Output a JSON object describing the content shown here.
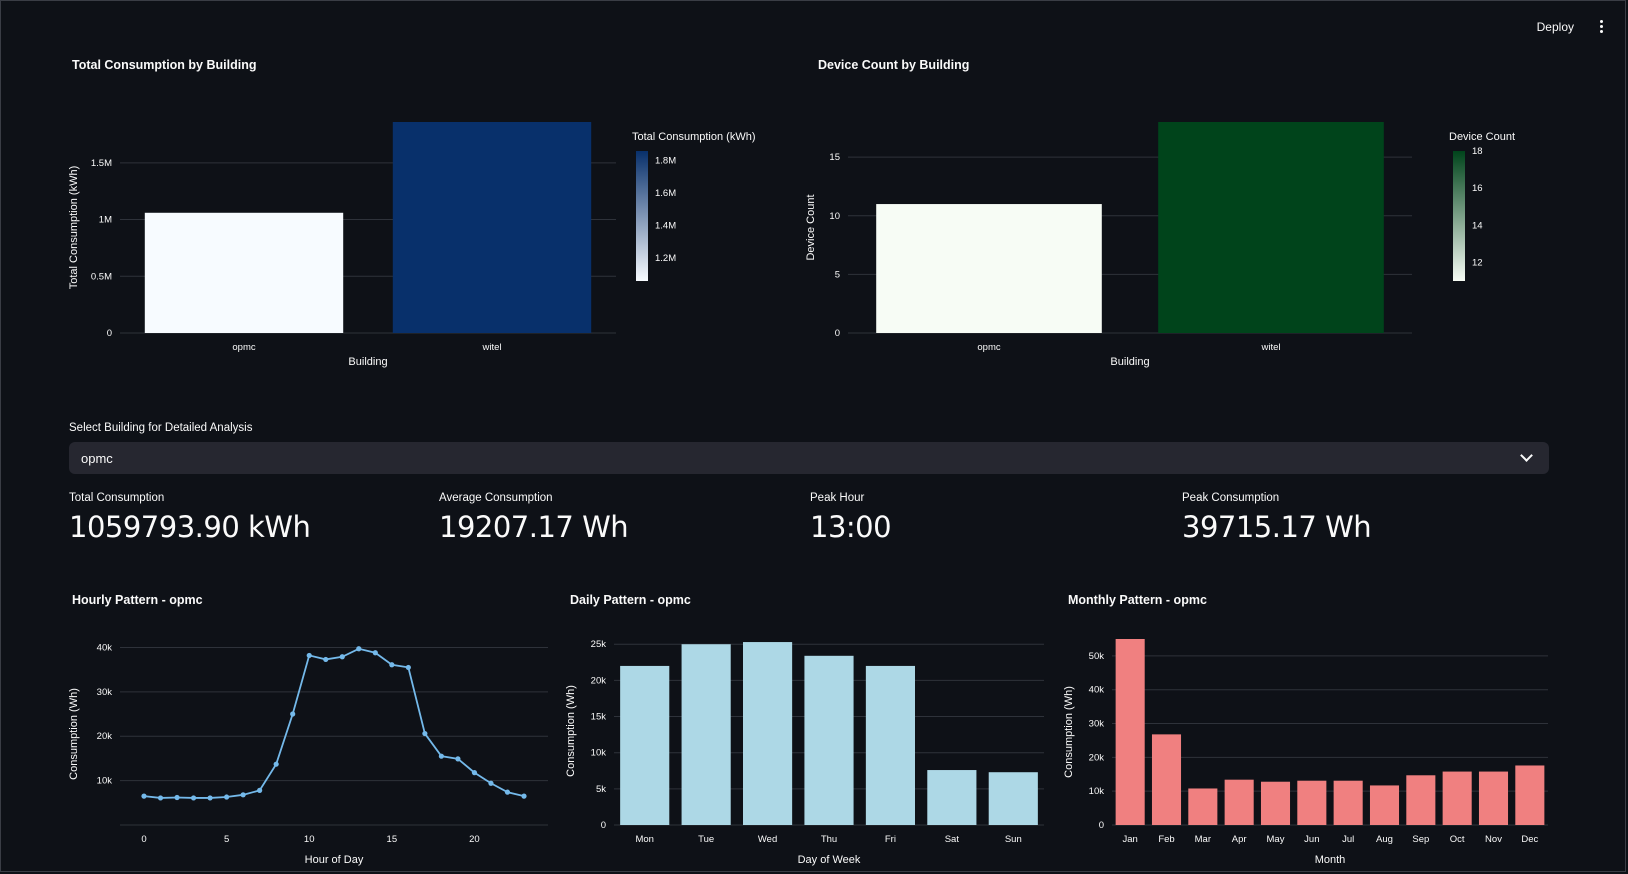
{
  "header": {
    "deploy_label": "Deploy",
    "menu_icon": "kebab-menu-icon"
  },
  "consumption_chart": {
    "title": "Total Consumption by Building",
    "xlabel": "Building",
    "ylabel": "Total Consumption (kWh)",
    "colorbar_title": "Total Consumption (kWh)",
    "colorbar_ticks": [
      "1.8M",
      "1.6M",
      "1.4M",
      "1.2M"
    ]
  },
  "device_chart": {
    "title": "Device Count by Building",
    "xlabel": "Building",
    "ylabel": "Device Count",
    "colorbar_title": "Device Count",
    "colorbar_ticks": [
      "18",
      "16",
      "14",
      "12"
    ]
  },
  "selector": {
    "label": "Select Building for Detailed Analysis",
    "value": "opmc",
    "chevron_icon": "chevron-down-icon"
  },
  "metrics": [
    {
      "label": "Total Consumption",
      "value": "1059793.90 kWh"
    },
    {
      "label": "Average Consumption",
      "value": "19207.17 Wh"
    },
    {
      "label": "Peak Hour",
      "value": "13:00"
    },
    {
      "label": "Peak Consumption",
      "value": "39715.17 Wh"
    }
  ],
  "chart_data": [
    {
      "type": "bar",
      "title": "Total Consumption by Building",
      "xlabel": "Building",
      "ylabel": "Total Consumption (kWh)",
      "categories": [
        "opmc",
        "witel"
      ],
      "values": [
        1059793.9,
        1860000
      ],
      "ylim": [
        0,
        1860000
      ],
      "yticks": [
        0,
        500000,
        1000000,
        1500000
      ],
      "ytick_labels": [
        "0",
        "0.5M",
        "1M",
        "1.5M"
      ],
      "colorscale": "Blues",
      "colors": [
        "#f7fbff",
        "#08306b"
      ],
      "legend": "colorbar-right"
    },
    {
      "type": "bar",
      "title": "Device Count by Building",
      "xlabel": "Building",
      "ylabel": "Device Count",
      "categories": [
        "opmc",
        "witel"
      ],
      "values": [
        11,
        18
      ],
      "ylim": [
        0,
        18
      ],
      "yticks": [
        0,
        5,
        10,
        15
      ],
      "ytick_labels": [
        "0",
        "5",
        "10",
        "15"
      ],
      "colorscale": "Greens",
      "colors": [
        "#f7fcf5",
        "#00441b"
      ],
      "legend": "colorbar-right"
    },
    {
      "type": "line",
      "title": "Hourly Pattern - opmc",
      "xlabel": "Hour of Day",
      "ylabel": "Consumption (Wh)",
      "x": [
        0,
        1,
        2,
        3,
        4,
        5,
        6,
        7,
        8,
        9,
        10,
        11,
        12,
        13,
        14,
        15,
        16,
        17,
        18,
        19,
        20,
        21,
        22,
        23
      ],
      "y": [
        6500,
        6100,
        6200,
        6100,
        6100,
        6300,
        6800,
        7800,
        13700,
        25000,
        38200,
        37300,
        37900,
        39700,
        38800,
        36100,
        35500,
        20600,
        15500,
        14900,
        11800,
        9400,
        7400,
        6500
      ],
      "ylim": [
        0,
        41000
      ],
      "yticks": [
        10000,
        20000,
        30000,
        40000
      ],
      "ytick_labels": [
        "10k",
        "20k",
        "30k",
        "40k"
      ],
      "xticks": [
        0,
        5,
        10,
        15,
        20
      ],
      "xtick_labels": [
        "0",
        "5",
        "10",
        "15",
        "20"
      ],
      "color": "#74b9ea"
    },
    {
      "type": "bar",
      "title": "Daily Pattern - opmc",
      "xlabel": "Day of Week",
      "ylabel": "Consumption (Wh)",
      "categories": [
        "Mon",
        "Tue",
        "Wed",
        "Thu",
        "Fri",
        "Sat",
        "Sun"
      ],
      "values": [
        22000,
        25000,
        25300,
        23400,
        22000,
        7600,
        7300
      ],
      "ylim": [
        0,
        26000
      ],
      "yticks": [
        0,
        5000,
        10000,
        15000,
        20000,
        25000
      ],
      "ytick_labels": [
        "0",
        "5k",
        "10k",
        "15k",
        "20k",
        "25k"
      ],
      "color": "#add8e6"
    },
    {
      "type": "bar",
      "title": "Monthly Pattern - opmc",
      "xlabel": "Month",
      "ylabel": "Consumption (Wh)",
      "categories": [
        "Jan",
        "Feb",
        "Mar",
        "Apr",
        "May",
        "Jun",
        "Jul",
        "Aug",
        "Sep",
        "Oct",
        "Nov",
        "Dec"
      ],
      "values": [
        55000,
        26800,
        10800,
        13400,
        12800,
        13100,
        13100,
        11700,
        14700,
        15800,
        15800,
        17600
      ],
      "ylim": [
        0,
        55000
      ],
      "yticks": [
        0,
        10000,
        20000,
        30000,
        40000,
        50000
      ],
      "ytick_labels": [
        "0",
        "10k",
        "20k",
        "30k",
        "40k",
        "50k"
      ],
      "color": "#f08080"
    }
  ]
}
